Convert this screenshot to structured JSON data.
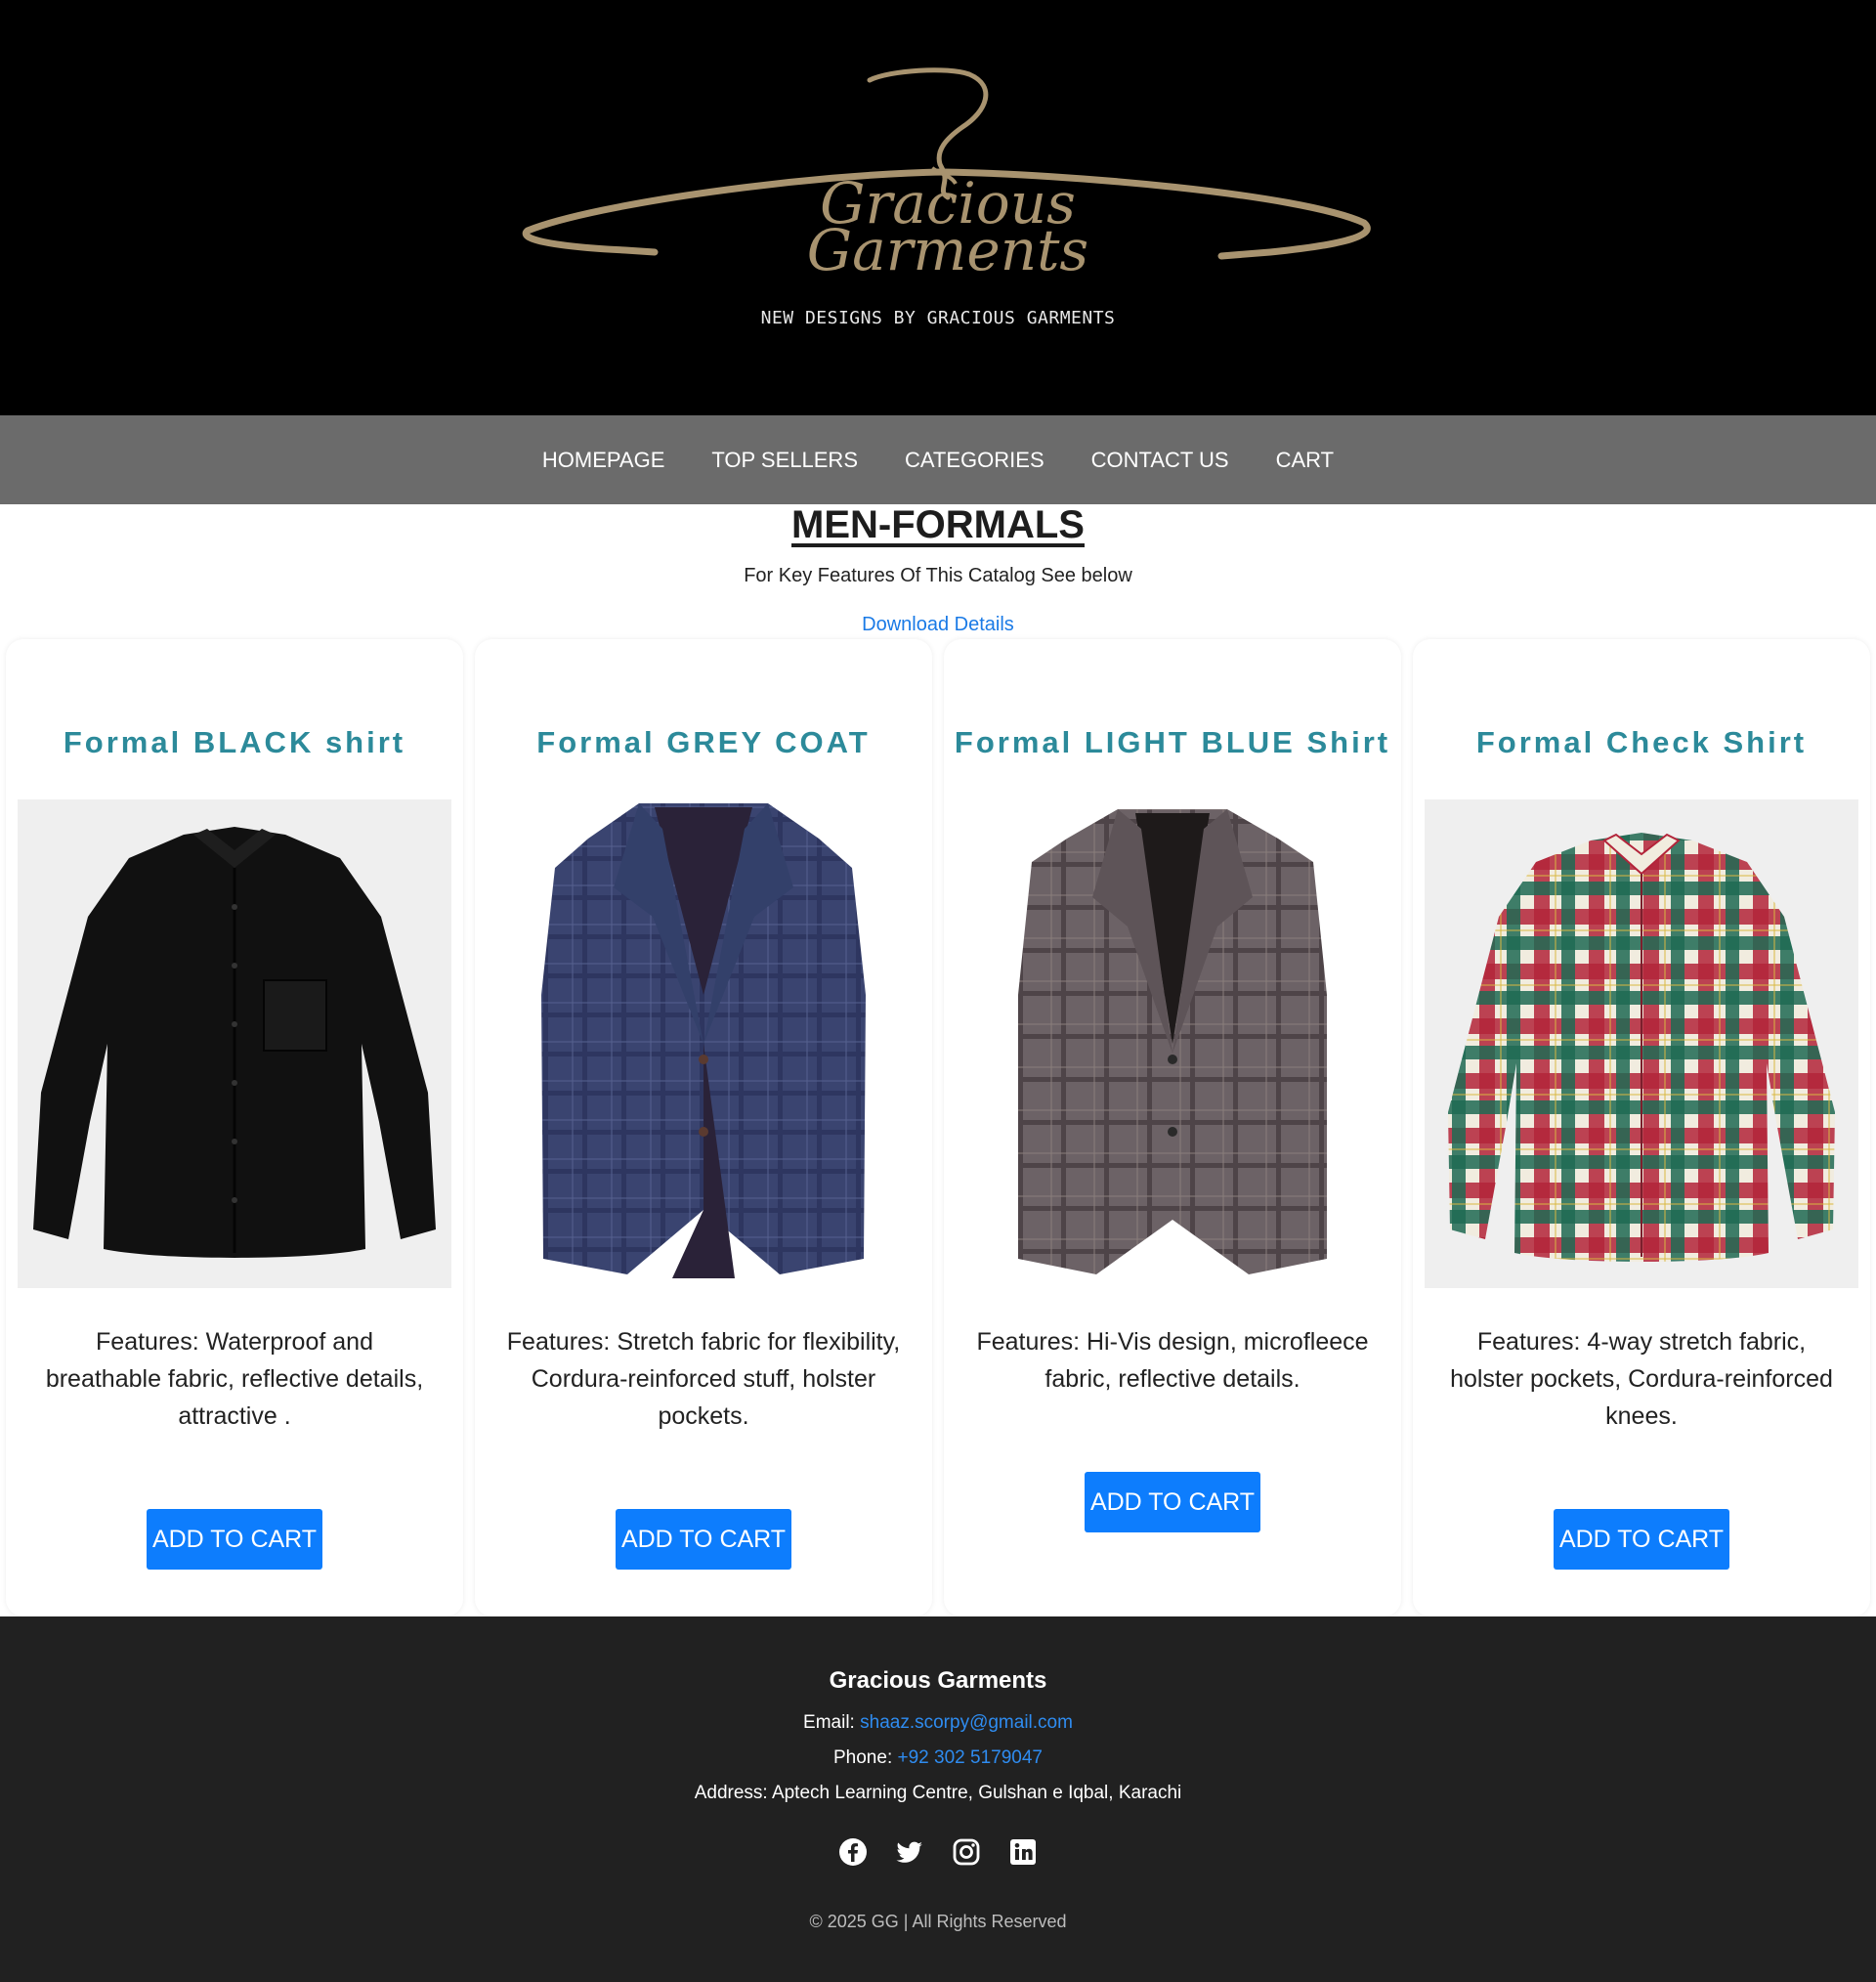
{
  "header": {
    "logo_line1": "Gracious",
    "logo_line2": "Garments",
    "tagline": "NEW DESIGNS BY GRACIOUS GARMENTS"
  },
  "nav": {
    "items": [
      {
        "label": "HOMEPAGE"
      },
      {
        "label": "TOP SELLERS"
      },
      {
        "label": "CATEGORIES"
      },
      {
        "label": "CONTACT US"
      },
      {
        "label": "CART"
      }
    ]
  },
  "intro": {
    "title": "MEN-FORMALS",
    "subtitle": "For Key Features Of This Catalog See below",
    "download_label": "Download Details"
  },
  "products": [
    {
      "title": "Formal BLACK shirt",
      "image": "black-shirt",
      "description": "Features: Waterproof and breathable fabric, reflective details, attractive .",
      "button": "ADD TO CART"
    },
    {
      "title": "Formal GREY COAT",
      "image": "navy-plaid-blazer",
      "description": "Features: Stretch fabric for flexibility, Cordura-reinforced stuff, holster pockets.",
      "button": "ADD TO CART"
    },
    {
      "title": "Formal LIGHT BLUE Shirt",
      "image": "grey-plaid-blazer",
      "description": "Features: Hi-Vis design, microfleece fabric, reflective details.",
      "button": "ADD TO CART"
    },
    {
      "title": "Formal Check Shirt",
      "image": "red-green-check-shirt",
      "description": "Features: 4-way stretch fabric, holster pockets, Cordura-reinforced knees.",
      "button": "ADD TO CART"
    }
  ],
  "footer": {
    "brand": "Gracious Garments",
    "email_label": "Email:",
    "email": "shaaz.scorpy@gmail.com",
    "phone_label": "Phone:",
    "phone": "+92 302 5179047",
    "address": "Address: Aptech Learning Centre, Gulshan e Iqbal, Karachi",
    "socials": [
      "facebook-icon",
      "twitter-icon",
      "instagram-icon",
      "linkedin-icon"
    ],
    "copyright": "© 2025 GG | All Rights Reserved"
  },
  "colors": {
    "header_bg": "#000000",
    "nav_bg": "#6b6b6b",
    "logo_gold": "#a8936f",
    "card_title": "#2c8a9a",
    "button": "#0d7dfd",
    "footer_bg": "#212121",
    "link": "#2f8cf0"
  }
}
